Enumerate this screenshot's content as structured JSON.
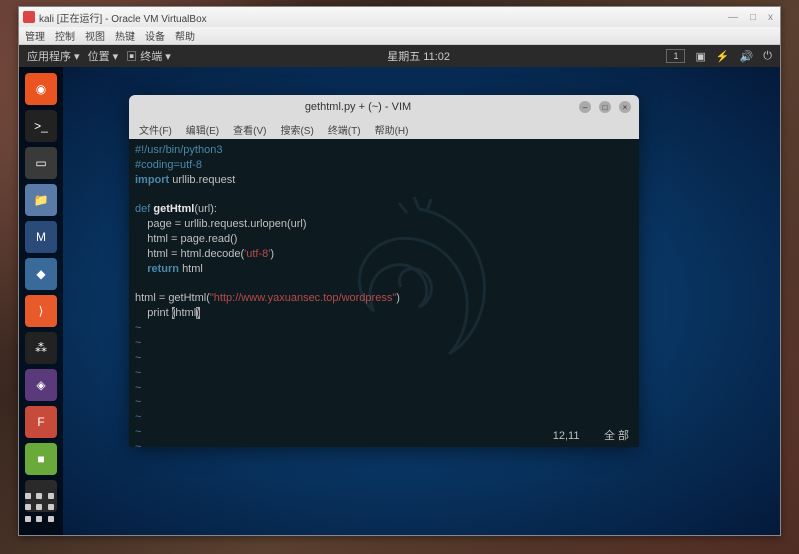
{
  "vbox": {
    "title": "kali [正在运行] - Oracle VM VirtualBox",
    "menus": [
      "管理",
      "控制",
      "视图",
      "热键",
      "设备",
      "帮助"
    ],
    "minimize": "—",
    "maximize": "□",
    "close": "x"
  },
  "kali_topbar": {
    "app_menu": "应用程序 ▾",
    "places": "位置 ▾",
    "terminal": "▣ 终端 ▾",
    "clock": "星期五 11:02",
    "workspace": "1"
  },
  "dock": {
    "items": [
      {
        "name": "ubuntu",
        "color": "#e95420",
        "glyph": "◉"
      },
      {
        "name": "terminal",
        "color": "#222",
        "glyph": ">_"
      },
      {
        "name": "files-dark",
        "color": "#3a3a3a",
        "glyph": "▭"
      },
      {
        "name": "files",
        "color": "#5a7aa8",
        "glyph": "📁"
      },
      {
        "name": "metasploit",
        "color": "#2a4a7a",
        "glyph": "M"
      },
      {
        "name": "tool-blue",
        "color": "#3a6a9a",
        "glyph": "◆"
      },
      {
        "name": "burp",
        "color": "#e85a2a",
        "glyph": "⟩"
      },
      {
        "name": "colors",
        "color": "#222",
        "glyph": "⁂"
      },
      {
        "name": "tool-purple",
        "color": "#5a3a7a",
        "glyph": "◈"
      },
      {
        "name": "tool-red",
        "color": "#c84a3a",
        "glyph": "F"
      },
      {
        "name": "tool-green",
        "color": "#6aaa3a",
        "glyph": "■"
      },
      {
        "name": "tool-dark2",
        "color": "#2a2a2a",
        "glyph": "◐"
      }
    ]
  },
  "vim": {
    "title": "gethtml.py + (~) - VIM",
    "menus": [
      "文件(F)",
      "编辑(E)",
      "查看(V)",
      "搜索(S)",
      "终端(T)",
      "帮助(H)"
    ],
    "status_pos": "12,11",
    "status_mode": "全 部"
  },
  "code": {
    "l1_a": "#!/usr/bin/python3",
    "l2_a": "#coding=utf-8",
    "l3_kw": "import ",
    "l3_id": "urllib.request",
    "l5_kw": "def ",
    "l5_fn": "getHtml",
    "l5_rest": "(url):",
    "l6_a": "    page = urllib.request.urlopen(url)",
    "l7_a": "    html = page.read()",
    "l8_a": "    html = html.decode(",
    "l8_str": "'utf-8'",
    "l8_b": ")",
    "l9_kw": "    return ",
    "l9_id": "html",
    "l11_a": "html = getHtml(",
    "l11_str": "\"http://www.yaxuansec.top/wordpress\"",
    "l11_b": ")",
    "l12_a": "    print ",
    "l12_cur": "(",
    "l12_b": "html",
    "l12_c": ")",
    "tilde": "~"
  }
}
